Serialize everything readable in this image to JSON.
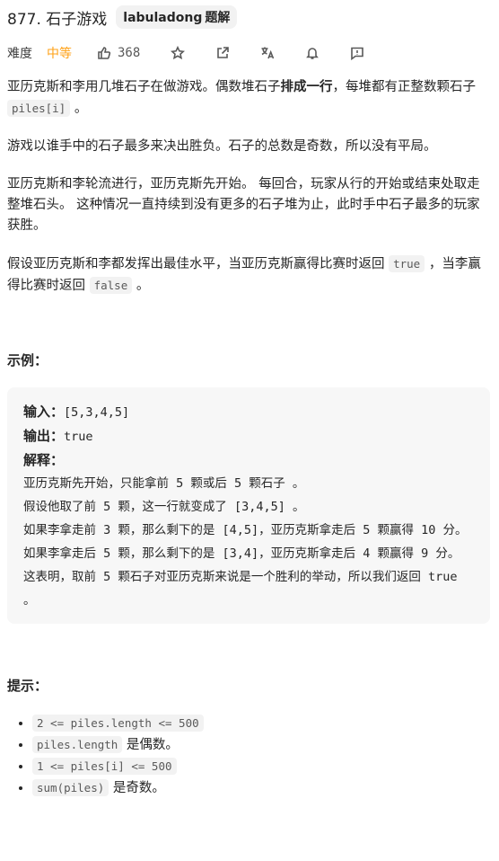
{
  "problem": {
    "title": "877. 石子游戏",
    "tag_brand": "labuladong",
    "tag_suffix": "题解"
  },
  "meta": {
    "difficulty_label": "难度",
    "difficulty": "中等",
    "likes": "368",
    "icons": [
      "thumb-up-icon",
      "star-icon",
      "share-icon",
      "translate-icon",
      "bell-icon",
      "feedback-icon"
    ]
  },
  "desc": {
    "p1_a": "亚历克斯和李用几堆石子在做游戏。偶数堆石子",
    "p1_bold": "排成一行",
    "p1_b": "，每堆都有正整数颗石子 ",
    "p1_code": "piles[i]",
    "p1_c": " 。",
    "p2": "游戏以谁手中的石子最多来决出胜负。石子的总数是奇数，所以没有平局。",
    "p3": "亚历克斯和李轮流进行，亚历克斯先开始。 每回合，玩家从行的开始或结束处取走整堆石头。 这种情况一直持续到没有更多的石子堆为止，此时手中石子最多的玩家获胜。",
    "p4_a": "假设亚历克斯和李都发挥出最佳水平，当亚历克斯赢得比赛时返回 ",
    "p4_code1": "true",
    "p4_b": " ，当李赢得比赛时返回 ",
    "p4_code2": "false",
    "p4_c": " 。"
  },
  "example": {
    "heading": "示例：",
    "input_label": "输入：",
    "input": "[5,3,4,5]",
    "output_label": "输出：",
    "output": "true",
    "explain_label": "解释：",
    "lines": [
      "亚历克斯先开始，只能拿前 5 颗或后 5 颗石子 。",
      "假设他取了前 5 颗，这一行就变成了 [3,4,5] 。",
      "如果李拿走前 3 颗，那么剩下的是 [4,5]，亚历克斯拿走后 5 颗赢得 10 分。",
      "如果李拿走后 5 颗，那么剩下的是 [3,4]，亚历克斯拿走后 4 颗赢得 9 分。",
      "这表明，取前 5 颗石子对亚历克斯来说是一个胜利的举动，所以我们返回 true 。"
    ]
  },
  "tips": {
    "heading": "提示：",
    "items": [
      {
        "code": "2 <= piles.length <= 500",
        "text": ""
      },
      {
        "code": "piles.length",
        "text": " 是偶数。"
      },
      {
        "code": "1 <= piles[i] <= 500",
        "text": ""
      },
      {
        "code": "sum(piles)",
        "text": " 是奇数。"
      }
    ]
  },
  "colors": {
    "medium": "#ffa116",
    "code_bg": "#f2f2f2",
    "example_bg": "#f7f7f7"
  }
}
